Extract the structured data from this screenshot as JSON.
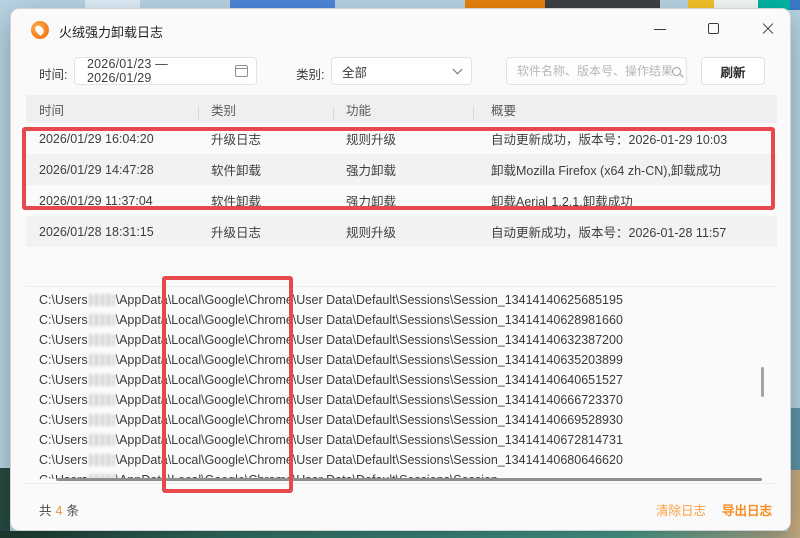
{
  "window": {
    "title": "火绒强力卸载日志"
  },
  "filters": {
    "time_label": "时间:",
    "date_range": "2026/01/23 — 2026/01/29",
    "category_label": "类别:",
    "category_value": "全部",
    "search_placeholder": "软件名称、版本号、操作结果",
    "refresh_label": "刷新"
  },
  "table": {
    "columns": [
      "时间",
      "类别",
      "功能",
      "概要"
    ],
    "rows": [
      {
        "time": "2026/01/29 16:04:20",
        "category": "升级日志",
        "function": "规则升级",
        "summary": "自动更新成功，版本号：2026-01-29 10:03"
      },
      {
        "time": "2026/01/29 14:47:28",
        "category": "软件卸载",
        "function": "强力卸载",
        "summary": "卸载Mozilla Firefox (x64 zh-CN),卸载成功"
      },
      {
        "time": "2026/01/29 11:37:04",
        "category": "软件卸载",
        "function": "强力卸载",
        "summary": "卸载Aerial 1.2.1,卸载成功"
      },
      {
        "time": "2026/01/28 18:31:15",
        "category": "升级日志",
        "function": "规则升级",
        "summary": "自动更新成功，版本号：2026-01-28 11:57"
      }
    ]
  },
  "paths": {
    "prefix": "C:\\Users",
    "middle": "\\AppData\\Local\\Google\\Chrome\\User Data\\Default\\Sessions\\Session_",
    "sessions": [
      "13414140625685195",
      "13414140628981660",
      "13414140632387200",
      "13414140635203899",
      "13414140640651527",
      "13414140666723370",
      "13414140669528930",
      "13414140672814731",
      "13414140680646620",
      ""
    ]
  },
  "footer": {
    "total_prefix": "共",
    "total_count": "4",
    "total_suffix": "条",
    "clear_label": "清除日志",
    "export_label": "导出日志"
  },
  "colors": {
    "accent_orange": "#f78d1e",
    "annotation_red": "#e5484d",
    "app_icon_orange": "#f5821f"
  }
}
